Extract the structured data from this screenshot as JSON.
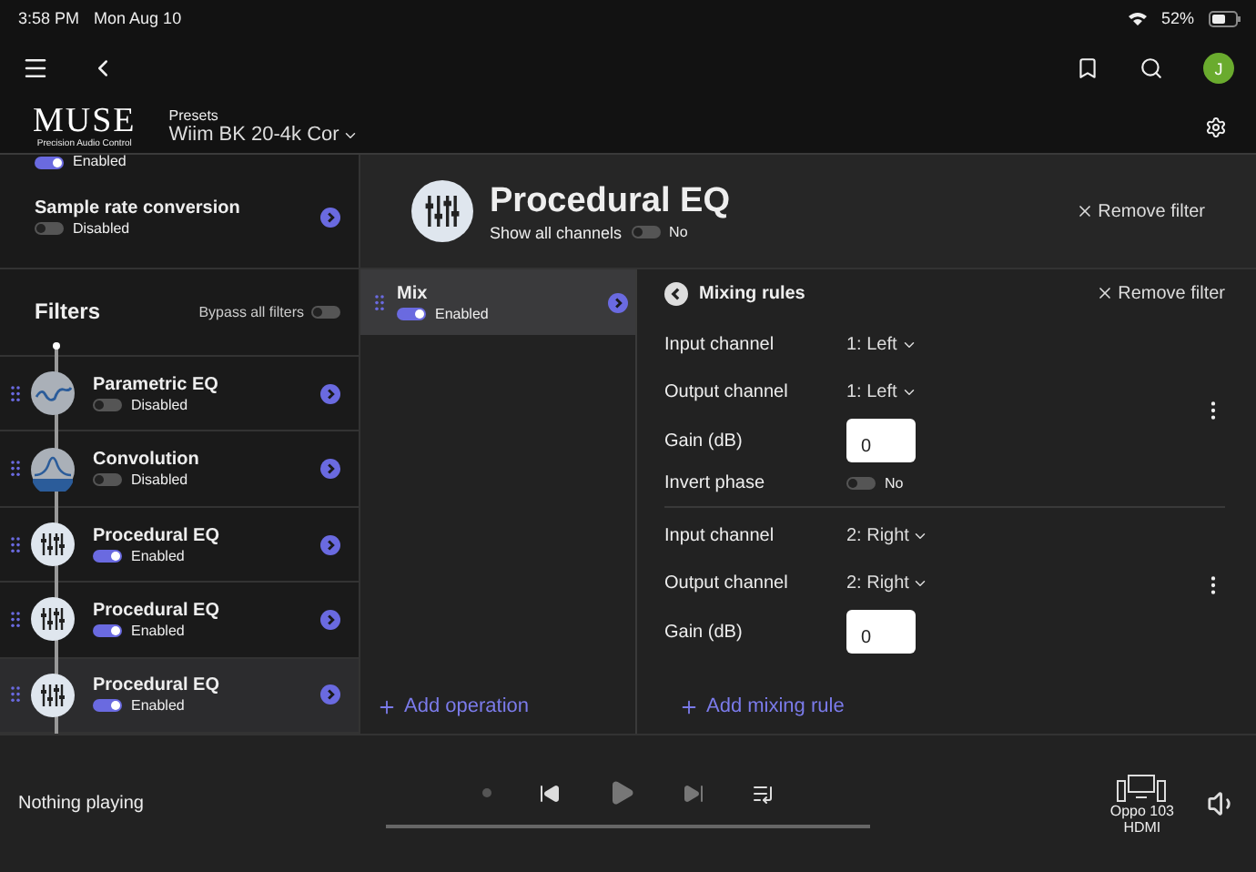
{
  "status_bar": {
    "time": "3:58 PM",
    "date": "Mon Aug 10",
    "battery": "52%"
  },
  "header": {
    "avatar": "J",
    "logo_title": "MUSE",
    "logo_subtitle": "Precision Audio Control",
    "presets_label": "Presets",
    "preset": "Wiim BK 20-4k Cor"
  },
  "sidebar": {
    "partial_item": {
      "status": "Enabled",
      "on": true
    },
    "settings": [
      {
        "name": "Sample rate conversion",
        "status": "Disabled",
        "on": false
      }
    ],
    "filters_title": "Filters",
    "bypass_label": "Bypass all filters",
    "bypass_on": false,
    "filters": [
      {
        "kind": "parametric",
        "name": "Parametric EQ",
        "status": "Disabled",
        "on": false,
        "selected": false
      },
      {
        "kind": "convolution",
        "name": "Convolution",
        "status": "Disabled",
        "on": false,
        "selected": false
      },
      {
        "kind": "procedural",
        "name": "Procedural EQ",
        "status": "Enabled",
        "on": true,
        "selected": false
      },
      {
        "kind": "procedural",
        "name": "Procedural EQ",
        "status": "Enabled",
        "on": true,
        "selected": false
      },
      {
        "kind": "procedural",
        "name": "Procedural EQ",
        "status": "Enabled",
        "on": true,
        "selected": true
      }
    ]
  },
  "detail": {
    "title": "Procedural EQ",
    "show_all_label": "Show all channels",
    "show_all_on": false,
    "show_all_value": "No",
    "remove": "Remove filter",
    "operations": [
      {
        "name": "Mix",
        "status": "Enabled",
        "on": true,
        "selected": true
      }
    ],
    "add_operation": "Add operation"
  },
  "mixing": {
    "title": "Mixing rules",
    "remove": "Remove filter",
    "rules": [
      {
        "input_label": "Input channel",
        "input": "1: Left",
        "output_label": "Output channel",
        "output": "1: Left",
        "gain_label": "Gain (dB)",
        "gain": "0",
        "invert": {
          "label": "Invert phase",
          "on": false,
          "value": "No"
        }
      },
      {
        "input_label": "Input channel",
        "input": "2: Right",
        "output_label": "Output channel",
        "output": "2: Right",
        "gain_label": "Gain (dB)",
        "gain": "0"
      }
    ],
    "add_rule": "Add mixing rule"
  },
  "player": {
    "now_playing": "Nothing playing",
    "device": "Oppo 103",
    "device_sub": "HDMI"
  }
}
